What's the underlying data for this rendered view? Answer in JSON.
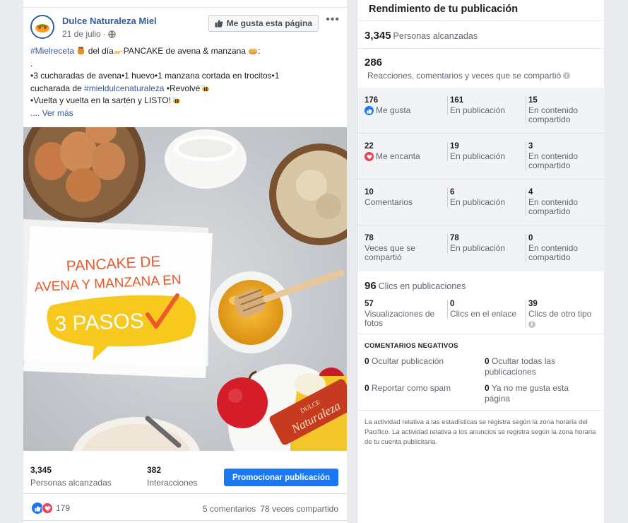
{
  "post": {
    "page_name": "Dulce Naturaleza Miel",
    "date": "21 de julio",
    "like_page_label": "Me gusta esta página",
    "text": {
      "hashtag1": "#Mielreceta",
      "line1_mid": " del día",
      "line1_end": "PANCAKE de avena & manzana ",
      "dot": ".",
      "line2": "•3 cucharadas de avena•1 huevo•1 manzana cortada en trocitos•1",
      "line3_start": "cucharada de ",
      "hashtag2": "#mieldulcenaturaleza",
      "line3_end": " •Revolvé",
      "line4": "•Vuelta y vuelta en la sartén y LISTO!",
      "see_more": ".... Ver más"
    },
    "image": {
      "headline_line1": "PANCAKE DE",
      "headline_line2": "AVENA Y MANZANA EN",
      "bubble_text": "3 PASOS",
      "brand_top": "DULCE",
      "brand_main": "Naturaleza"
    },
    "stats": {
      "reach_value": "3,345",
      "reach_label": "Personas alcanzadas",
      "interactions_value": "382",
      "interactions_label": "Interacciones",
      "promote_label": "Promocionar publicación"
    },
    "reactions": {
      "count": "179",
      "comments": "5 comentarios",
      "shares": "78 veces compartido"
    }
  },
  "performance": {
    "title": "Rendimiento de tu publicación",
    "reach_value": "3,345",
    "reach_label": "Personas alcanzadas",
    "reactions_total": "286",
    "reactions_desc": "Reacciones, comentarios y veces que se compartió",
    "breakdown": [
      {
        "total": "176",
        "label": "Me gusta",
        "icon": "like",
        "on_post": "161",
        "on_post_label": "En publicación",
        "on_shares": "15",
        "on_shares_label": "En contenido compartido"
      },
      {
        "total": "22",
        "label": "Me encanta",
        "icon": "love",
        "on_post": "19",
        "on_post_label": "En publicación",
        "on_shares": "3",
        "on_shares_label": "En contenido compartido"
      },
      {
        "total": "10",
        "label": "Comentarios",
        "icon": "",
        "on_post": "6",
        "on_post_label": "En publicación",
        "on_shares": "4",
        "on_shares_label": "En contenido compartido"
      },
      {
        "total": "78",
        "label": "Veces que se compartió",
        "icon": "",
        "on_post": "78",
        "on_post_label": "En publicación",
        "on_shares": "0",
        "on_shares_label": "En contenido compartido"
      }
    ],
    "clicks_value": "96",
    "clicks_label": "Clics en publicaciones",
    "clicks": [
      {
        "value": "57",
        "label": "Visualizaciones de fotos"
      },
      {
        "value": "0",
        "label": "Clics en el enlace"
      },
      {
        "value": "39",
        "label": "Clics de otro tipo"
      }
    ],
    "negative_title": "COMENTARIOS NEGATIVOS",
    "negative": [
      {
        "value": "0",
        "label": "Ocultar publicación"
      },
      {
        "value": "0",
        "label": "Ocultar todas las publicaciones"
      },
      {
        "value": "0",
        "label": "Reportar como spam"
      },
      {
        "value": "0",
        "label": "Ya no me gusta esta página"
      }
    ],
    "footer_note": "La actividad relativa a las estadísticas se registra según la zona horaria del Pacífico. La actividad relativa a los anuncios se registra según la zona horaria de tu cuenta publicitaria."
  },
  "colors": {
    "link": "#385898",
    "primary_button": "#1877f2",
    "like": "#1877f2",
    "love": "#f33e58",
    "panel_gray": "#f2f3f5"
  }
}
